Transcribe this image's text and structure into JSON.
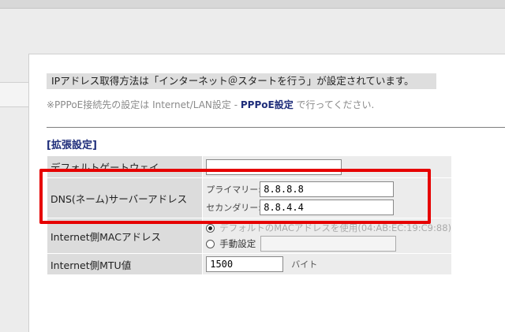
{
  "notice": "IPアドレス取得方法は「インターネット＠スタートを行う」が設定されています。",
  "note": {
    "prefix": "※PPPoE接続先の設定は Internet/LAN設定 - ",
    "link": "PPPoE設定",
    "suffix": " で行ってください."
  },
  "section_title": "[拡張設定]",
  "rows": {
    "gateway": {
      "label": "デフォルトゲートウェイ",
      "value": ""
    },
    "dns": {
      "label": "DNS(ネーム)サーバーアドレス",
      "primary_label": "プライマリー:",
      "primary_value": "8.8.8.8",
      "secondary_label": "セカンダリー:",
      "secondary_value": "8.8.4.4"
    },
    "mac": {
      "label": "Internet側MACアドレス",
      "option_default": "デフォルトのMACアドレスを使用(04:AB:EC:19:C9:88)",
      "option_manual": "手動設定",
      "manual_value": ""
    },
    "mtu": {
      "label": "Internet側MTU値",
      "value": "1500",
      "unit": "バイト"
    }
  },
  "colors": {
    "highlight": "#e60000",
    "link": "#1e2d7a"
  }
}
